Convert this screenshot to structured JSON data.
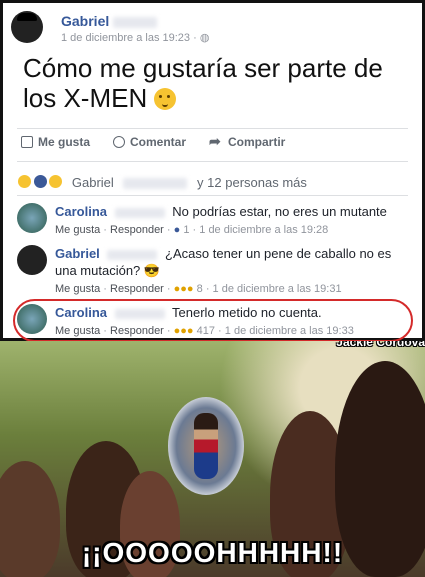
{
  "post": {
    "author": "Gabriel",
    "timestamp": "1 de diciembre a las 19:23 ·",
    "text": "Cómo me gustaría ser parte de los X-MEN",
    "actions": {
      "like": "Me gusta",
      "comment": "Comentar",
      "share": "Compartir"
    },
    "reactions_summary": {
      "name": "Gabriel",
      "others": "y 12 personas más"
    }
  },
  "comments": [
    {
      "author": "Carolina",
      "text": "No podrías estar, no eres un mutante",
      "like": "Me gusta",
      "reply": "Responder",
      "count": "1",
      "time": "1 de diciembre a las 19:28"
    },
    {
      "author": "Gabriel",
      "text": "¿Acaso tener un pene de caballo no es una mutación?",
      "like": "Me gusta",
      "reply": "Responder",
      "count": "8",
      "time": "1 de diciembre a las 19:31"
    },
    {
      "author": "Carolina",
      "text": "Tenerlo metido no cuenta.",
      "like": "Me gusta",
      "reply": "Responder",
      "count": "417",
      "time": "1 de diciembre a las 19:33"
    }
  ],
  "meme": {
    "watermark": "Jackie Cordova",
    "caption": "¡¡OOOOOHHHHH!!"
  },
  "colors": {
    "link": "#365899",
    "highlight": "#d42a2a"
  }
}
